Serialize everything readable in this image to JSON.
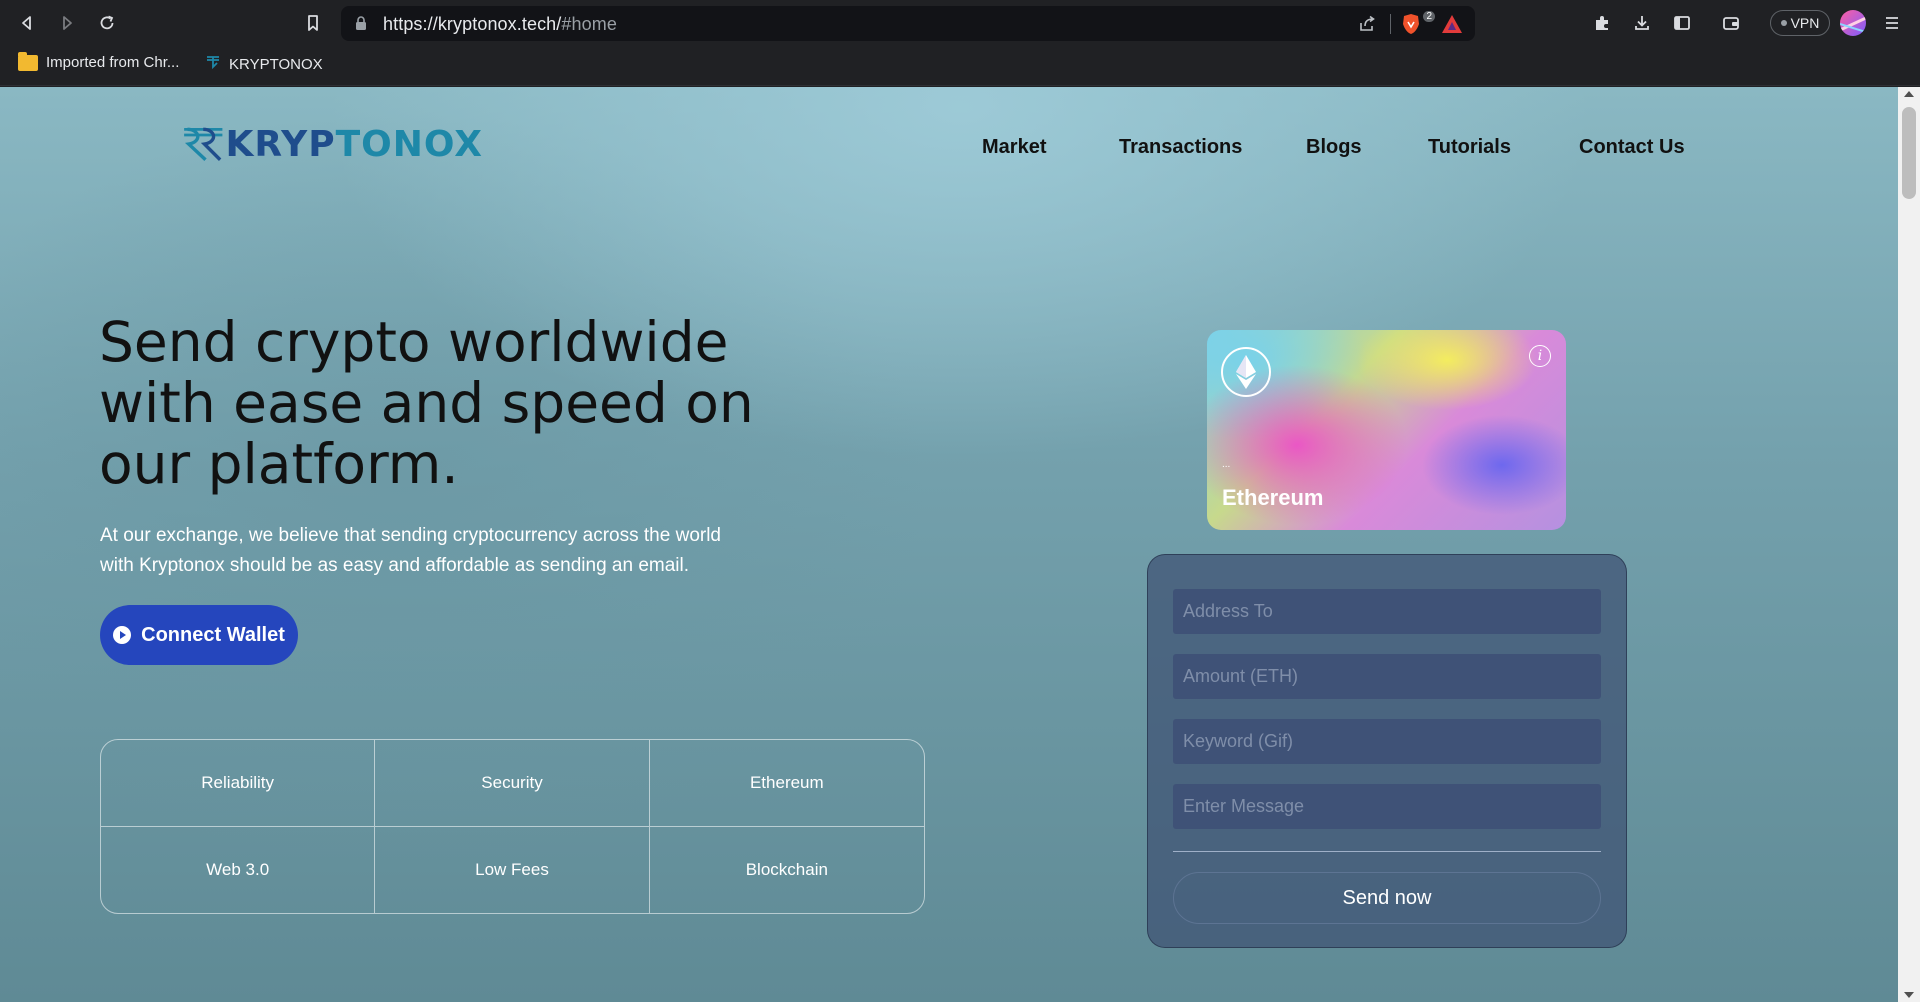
{
  "browser": {
    "url_host": "https://kryptonox.tech/",
    "url_path": "#home",
    "brave_shield_count": "2",
    "vpn_label": "VPN",
    "bookmarks": [
      {
        "label": "Imported from Chr...",
        "icon": "folder-icon"
      },
      {
        "label": "KRYPTONOX",
        "icon": "kryptonox-favicon"
      }
    ]
  },
  "site": {
    "logo_text_a": "KRYP",
    "logo_text_b": "TONOX",
    "nav": [
      "Market",
      "Transactions",
      "Blogs",
      "Tutorials",
      "Contact Us"
    ]
  },
  "hero": {
    "title": "Send crypto worldwide with ease and speed on our platform.",
    "subtitle": "At our exchange, we believe that sending cryptocurrency across the world with Kryptonox should be as easy and affordable as sending an email.",
    "connect_label": "Connect Wallet"
  },
  "features": [
    "Reliability",
    "Security",
    "Ethereum",
    "Web 3.0",
    "Low Fees",
    "Blockchain"
  ],
  "card": {
    "address": "...",
    "name": "Ethereum"
  },
  "form": {
    "address_placeholder": "Address To",
    "amount_placeholder": "Amount (ETH)",
    "keyword_placeholder": "Keyword (Gif)",
    "message_placeholder": "Enter Message",
    "send_label": "Send now"
  },
  "colors": {
    "connect_button": "#2546bd",
    "logo_blue": "#1f4d8c",
    "logo_teal": "#1e88a8",
    "form_panel": "#3e5273"
  }
}
